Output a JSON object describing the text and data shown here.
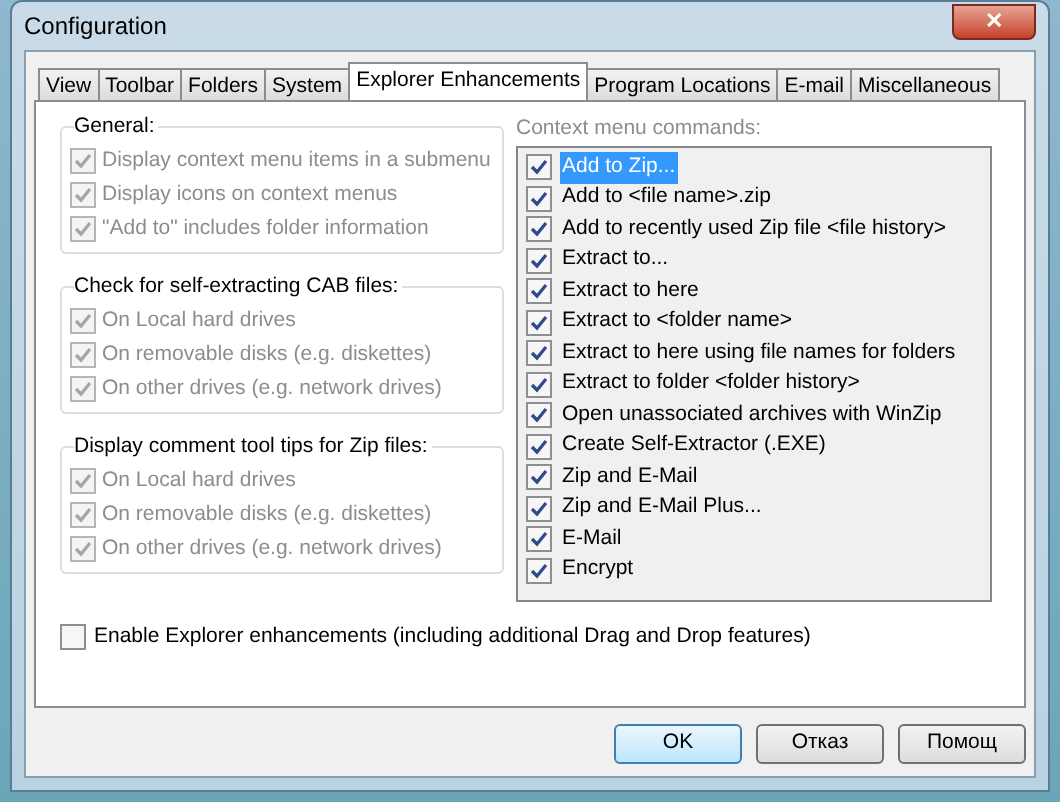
{
  "window": {
    "title": "Configuration",
    "close_label": "✕"
  },
  "tabs": [
    {
      "label": "View",
      "selected": false
    },
    {
      "label": "Toolbar",
      "selected": false
    },
    {
      "label": "Folders",
      "selected": false
    },
    {
      "label": "System",
      "selected": false
    },
    {
      "label": "Explorer Enhancements",
      "selected": true
    },
    {
      "label": "Program Locations",
      "selected": false
    },
    {
      "label": "E-mail",
      "selected": false
    },
    {
      "label": "Miscellaneous",
      "selected": false
    }
  ],
  "groups": [
    {
      "title": "General:",
      "options": [
        {
          "label": "Display context menu items in a submenu",
          "checked": true,
          "disabled": true
        },
        {
          "label": "Display icons on context menus",
          "checked": true,
          "disabled": true
        },
        {
          "label": "\"Add to\" includes folder information",
          "checked": true,
          "disabled": true
        }
      ]
    },
    {
      "title": "Check for self-extracting CAB files:",
      "options": [
        {
          "label": "On Local hard drives",
          "checked": true,
          "disabled": true
        },
        {
          "label": "On removable disks (e.g. diskettes)",
          "checked": true,
          "disabled": true
        },
        {
          "label": "On other drives (e.g. network drives)",
          "checked": true,
          "disabled": true
        }
      ]
    },
    {
      "title": "Display comment tool tips for Zip files:",
      "options": [
        {
          "label": "On Local hard drives",
          "checked": true,
          "disabled": true
        },
        {
          "label": "On removable disks (e.g. diskettes)",
          "checked": true,
          "disabled": true
        },
        {
          "label": "On other drives (e.g. network drives)",
          "checked": true,
          "disabled": true
        }
      ]
    }
  ],
  "context_menu": {
    "label": "Context menu commands:",
    "items": [
      {
        "label": "Add to Zip...",
        "checked": true,
        "selected": true
      },
      {
        "label": "Add to <file name>.zip",
        "checked": true,
        "selected": false
      },
      {
        "label": "Add to recently used Zip file <file history>",
        "checked": true,
        "selected": false
      },
      {
        "label": "Extract to...",
        "checked": true,
        "selected": false
      },
      {
        "label": "Extract to here",
        "checked": true,
        "selected": false
      },
      {
        "label": "Extract to <folder name>",
        "checked": true,
        "selected": false
      },
      {
        "label": "Extract to here using file names for folders",
        "checked": true,
        "selected": false
      },
      {
        "label": "Extract to folder <folder history>",
        "checked": true,
        "selected": false
      },
      {
        "label": "Open unassociated archives with WinZip",
        "checked": true,
        "selected": false
      },
      {
        "label": "Create Self-Extractor (.EXE)",
        "checked": true,
        "selected": false
      },
      {
        "label": "Zip and E-Mail",
        "checked": true,
        "selected": false
      },
      {
        "label": "Zip and E-Mail Plus...",
        "checked": true,
        "selected": false
      },
      {
        "label": "E-Mail",
        "checked": true,
        "selected": false
      },
      {
        "label": "Encrypt",
        "checked": true,
        "selected": false
      }
    ]
  },
  "enable_option": {
    "label": "Enable Explorer enhancements (including additional Drag and Drop features)",
    "checked": false
  },
  "buttons": [
    {
      "label": "OK",
      "default": true
    },
    {
      "label": "Отказ",
      "default": false
    },
    {
      "label": "Помощ",
      "default": false
    }
  ]
}
